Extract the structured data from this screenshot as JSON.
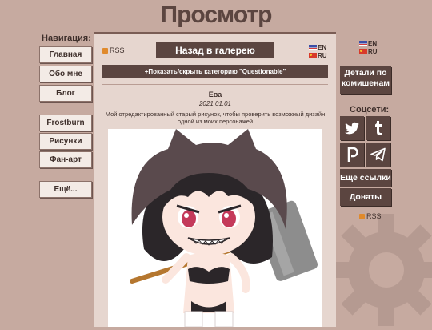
{
  "site_title": "Просмотр",
  "navigation": {
    "heading": "Навигация:",
    "items": [
      "Главная",
      "Обо мне",
      "Блог",
      "Frostburn",
      "Рисунки",
      "Фан-арт",
      "Ещё..."
    ]
  },
  "content": {
    "rss_label": "RSS",
    "back_label": "Назад в галерею",
    "lang_en": "EN",
    "lang_ru": "RU",
    "toggle_label": "+Показать/скрыть категорию \"Questionable\"",
    "art_title": "Ева",
    "art_date": "2021.01.01",
    "art_description": "Мой отредактированный старый рисунок, чтобы проверить возможный дизайн одной из моих персонажей"
  },
  "right_sidebar": {
    "lang_en": "EN",
    "lang_ru": "RU",
    "commissions_label": "Детали по комишенам",
    "socials_heading": "Соцсети:",
    "social_icons": [
      "twitter-icon",
      "tumblr-icon",
      "picarto-icon",
      "telegram-icon"
    ],
    "more_links_label": "Ещё ссылки",
    "donate_label": "Донаты",
    "rss_label": "RSS"
  },
  "colors": {
    "background": "#c6aaa0",
    "panel": "#e6d6cf",
    "accent_dark": "#5b4540",
    "button_light": "#f3ebe6",
    "rss_orange": "#e08a2c"
  }
}
